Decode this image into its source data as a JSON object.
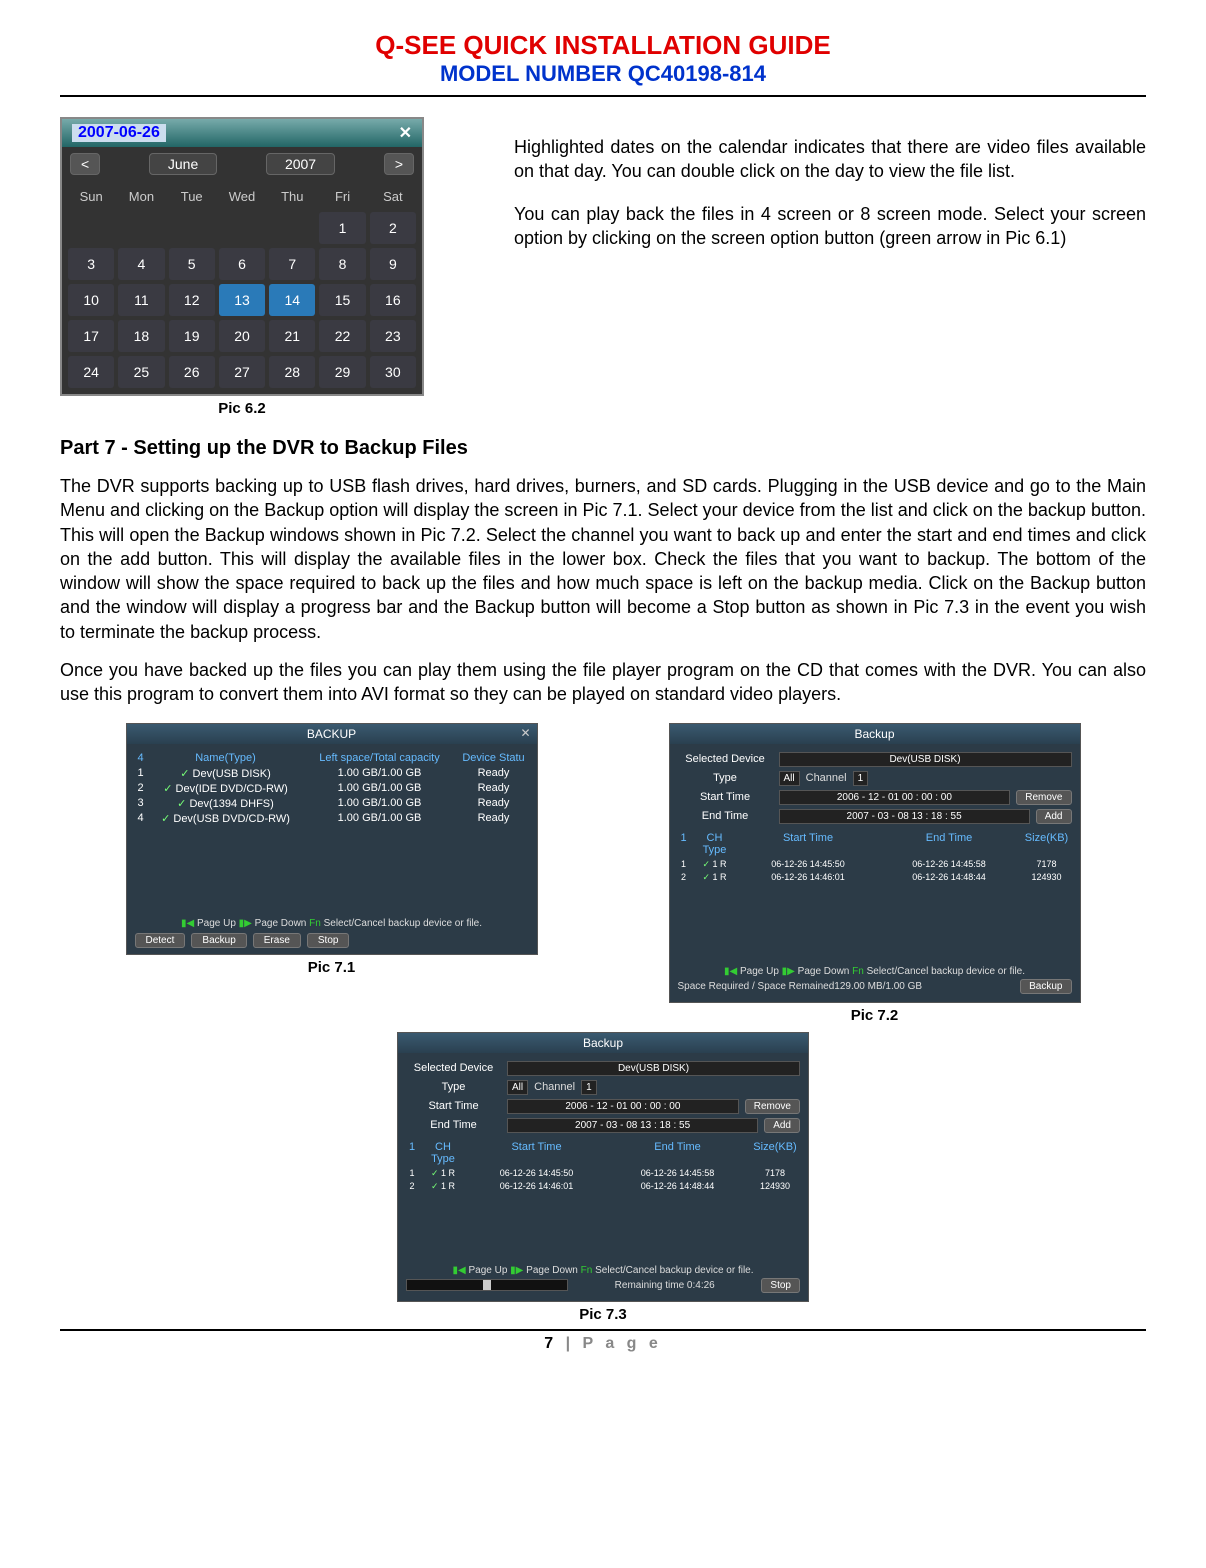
{
  "header": {
    "title": "Q-SEE QUICK INSTALLATION GUIDE",
    "subtitle": "MODEL NUMBER QC40198-814"
  },
  "calendar": {
    "title": "2007-06-26",
    "prev": "<",
    "next": ">",
    "month": "June",
    "year": "2007",
    "days": [
      "Sun",
      "Mon",
      "Tue",
      "Wed",
      "Thu",
      "Fri",
      "Sat"
    ],
    "cells": [
      "",
      "",
      "",
      "",
      "",
      "1",
      "2",
      "3",
      "4",
      "5",
      "6",
      "7",
      "8",
      "9",
      "10",
      "11",
      "12",
      "13",
      "14",
      "15",
      "16",
      "17",
      "18",
      "19",
      "20",
      "21",
      "22",
      "23",
      "24",
      "25",
      "26",
      "27",
      "28",
      "29",
      "30"
    ],
    "highlighted": [
      "13",
      "14"
    ],
    "label": "Pic 6.2"
  },
  "topright": {
    "p1": "Highlighted dates on the calendar indicates that there are video files available on that day. You can double click on the day to view the file list.",
    "p2": "You can play back the files in 4 screen or 8 screen mode. Select your screen option by clicking on the screen option button (green arrow in Pic 6.1)"
  },
  "section7": {
    "title": "Part 7 - Setting up the DVR to Backup Files",
    "p1": "The DVR supports backing up to USB flash drives, hard drives, burners, and SD cards. Plugging in the USB device and go to the Main Menu and clicking on the Backup option will display the screen in Pic 7.1. Select your device from the list and click on the backup button.  This will open the Backup windows shown in Pic 7.2. Select the channel you want to back up and enter the start and end times and click on the add button. This will display the available files in the lower box. Check the files that you want to backup. The bottom of the window will show the space required to back up the files and how much space is left on the backup media. Click on the Backup button and the window will display a progress bar and the Backup button will become a Stop button as shown in Pic 7.3 in the event you wish to terminate the backup process.",
    "p2": "Once you have backed up the files you can play them using the file player program on the CD that comes with the DVR. You can also use this program to convert them into AVI format so they can be played on standard video players."
  },
  "pic71": {
    "title": "BACKUP",
    "head_idx": "4",
    "head_name": "Name(Type)",
    "head_space": "Left space/Total capacity",
    "head_status": "Device Statu",
    "rows": [
      {
        "n": "1",
        "name": "Dev(USB DISK)",
        "space": "1.00 GB/1.00 GB",
        "st": "Ready"
      },
      {
        "n": "2",
        "name": "Dev(IDE DVD/CD-RW)",
        "space": "1.00 GB/1.00 GB",
        "st": "Ready"
      },
      {
        "n": "3",
        "name": "Dev(1394 DHFS)",
        "space": "1.00 GB/1.00 GB",
        "st": "Ready"
      },
      {
        "n": "4",
        "name": "Dev(USB DVD/CD-RW)",
        "space": "1.00 GB/1.00 GB",
        "st": "Ready"
      }
    ],
    "foot1": "Page Up",
    "foot2": "Page Down",
    "foot3": "Select/Cancel backup device or file.",
    "btns": [
      "Detect",
      "Backup",
      "Erase",
      "Stop"
    ],
    "label": "Pic 7.1"
  },
  "pic72": {
    "title": "Backup",
    "seldev_lbl": "Selected Device",
    "seldev": "Dev(USB DISK)",
    "type_lbl": "Type",
    "type": "All",
    "chan_lbl": "Channel",
    "chan": "1",
    "start_lbl": "Start Time",
    "start": "2006 - 12 - 01  00 : 00 : 00",
    "remove": "Remove",
    "end_lbl": "End Time",
    "end": "2007 - 03 - 08  13 : 18 : 55",
    "add": "Add",
    "thead_n": "1",
    "thead_ch": "CH Type",
    "thead_st": "Start Time",
    "thead_et": "End Time",
    "thead_sz": "Size(KB)",
    "rows": [
      {
        "n": "1",
        "ch": "1 R",
        "st": "06-12-26 14:45:50",
        "et": "06-12-26 14:45:58",
        "sz": "7178"
      },
      {
        "n": "2",
        "ch": "1 R",
        "st": "06-12-26 14:46:01",
        "et": "06-12-26 14:48:44",
        "sz": "124930"
      }
    ],
    "foot1": "Page Up",
    "foot2": "Page Down",
    "foot3": "Select/Cancel backup device or file.",
    "space": "Space Required / Space Remained129.00 MB/1.00 GB",
    "backup": "Backup",
    "label": "Pic 7.2"
  },
  "pic73": {
    "title": "Backup",
    "remaining": "Remaining time 0:4:26",
    "stop": "Stop",
    "label": "Pic 7.3"
  },
  "footer": {
    "page": "7",
    "suffix": "| P a g e"
  }
}
